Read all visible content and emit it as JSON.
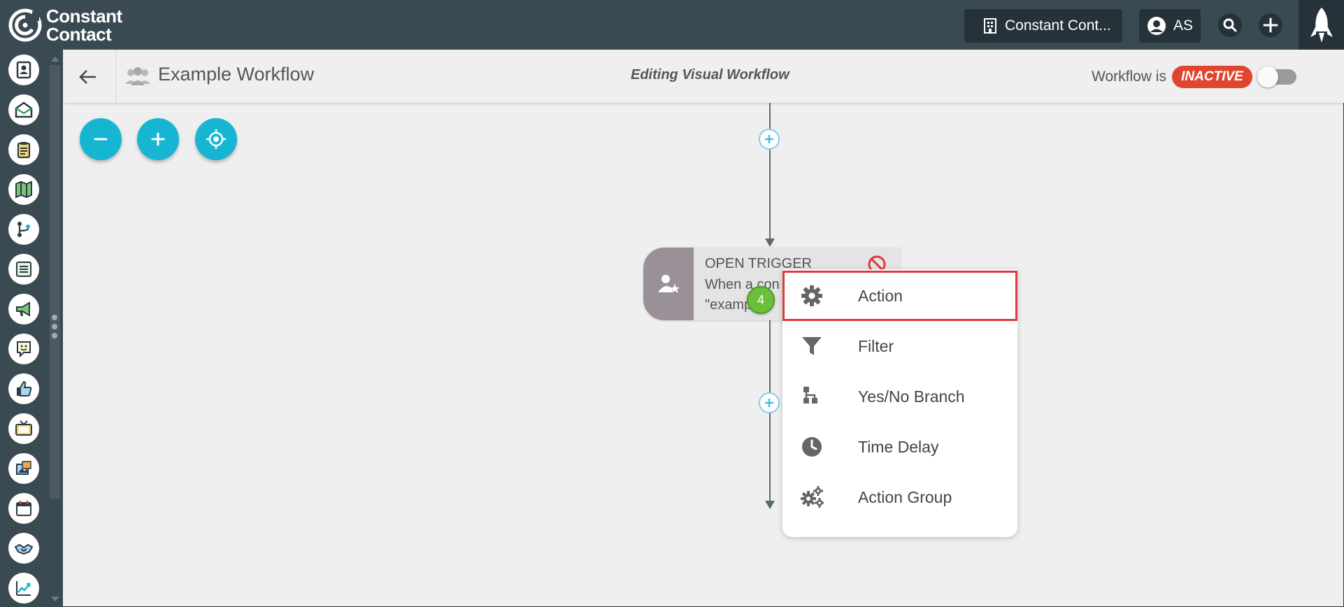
{
  "app": {
    "brand": "Constant Contact",
    "brand_line1": "Constant",
    "brand_line2": "Contact"
  },
  "topbar": {
    "org_button_label": "Constant Cont...",
    "user_initials": "AS",
    "icons": [
      "building-icon",
      "user-avatar-icon",
      "search-icon",
      "plus-icon",
      "rocket-icon"
    ]
  },
  "sidebar": {
    "items": [
      "contacts-icon",
      "email-icon",
      "clipboard-icon",
      "map-icon",
      "workflow-icon",
      "list-icon",
      "megaphone-icon",
      "feedback-icon",
      "thumbs-up-icon",
      "tv-icon",
      "media-icon",
      "calendar-icon",
      "handshake-icon",
      "reports-icon"
    ]
  },
  "header": {
    "title": "Example Workflow",
    "mode": "Editing Visual Workflow",
    "status_prefix": "Workflow is",
    "status": "INACTIVE"
  },
  "trigger": {
    "title": "OPEN TRIGGER",
    "line1": "When a con",
    "line2": "\"examp"
  },
  "step_badge": "4",
  "menu": {
    "items": [
      {
        "label": "Action",
        "icon": "gear-icon"
      },
      {
        "label": "Filter",
        "icon": "filter-icon"
      },
      {
        "label": "Yes/No Branch",
        "icon": "branch-icon"
      },
      {
        "label": "Time Delay",
        "icon": "clock-icon"
      },
      {
        "label": "Action Group",
        "icon": "gears-icon"
      }
    ]
  },
  "colors": {
    "topbar": "#3a4a52",
    "accent": "#16b6d3",
    "inactive": "#e0462f",
    "highlight_border": "#e0383e",
    "step_badge": "#6cbf3c"
  }
}
